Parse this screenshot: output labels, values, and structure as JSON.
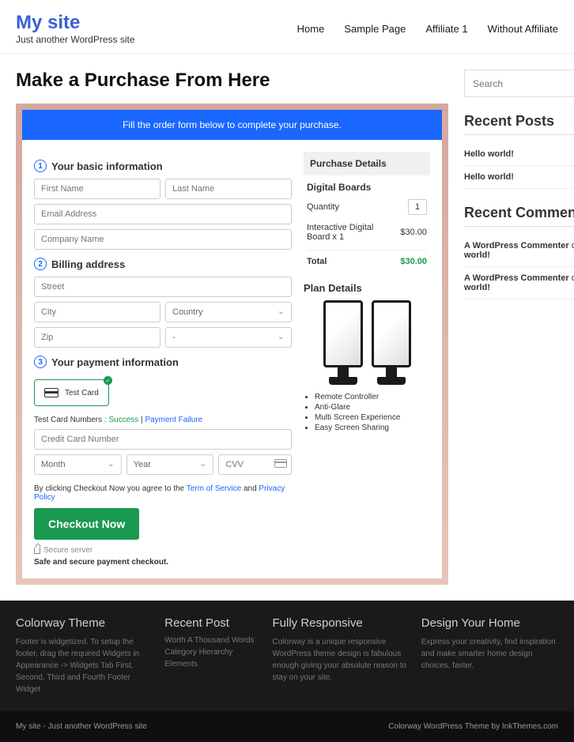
{
  "header": {
    "site_title": "My site",
    "tagline": "Just another WordPress site",
    "nav": [
      "Home",
      "Sample Page",
      "Affiliate 1",
      "Without Affiliate"
    ]
  },
  "page": {
    "title": "Make a Purchase From Here"
  },
  "form": {
    "banner": "Fill the order form below to complete your purchase.",
    "s1": {
      "num": "1",
      "title": "Your basic information",
      "first_name": "First Name",
      "last_name": "Last Name",
      "email": "Email Address",
      "company": "Company Name"
    },
    "s2": {
      "num": "2",
      "title": "Billing address",
      "street": "Street",
      "city": "City",
      "country": "Country",
      "zip": "Zip",
      "dash": "-"
    },
    "s3": {
      "num": "3",
      "title": "Your payment information",
      "card_label": "Test  Card",
      "test_prefix": "Test Card Numbers : ",
      "success": "Success",
      "sep": " | ",
      "failure": "Payment Failure",
      "ccnum": "Credit Card Number",
      "month": "Month",
      "year": "Year",
      "cvv": "CVV"
    },
    "agree": {
      "p1": "By clicking Checkout Now you agree to the ",
      "tos": "Term of Service",
      "and": " and ",
      "pp": "Privacy Policy"
    },
    "checkout": "Checkout Now",
    "secure": "Secure server",
    "safe": "Safe and secure payment checkout."
  },
  "purchase": {
    "head": "Purchase Details",
    "product": "Digital Boards",
    "qty_label": "Quantity",
    "qty": "1",
    "item": "Interactive Digital Board x 1",
    "price": "$30.00",
    "total_label": "Total",
    "total": "$30.00",
    "plan_title": "Plan Details",
    "features": [
      "Remote Controller",
      "Anti-Glare",
      "Multi Screen Experience",
      "Easy Screen Sharing"
    ]
  },
  "sidebar": {
    "search_placeholder": "Search",
    "recent_posts_title": "Recent Posts",
    "posts": [
      "Hello world!",
      "Hello world!"
    ],
    "recent_comments_title": "Recent Comments",
    "comments": [
      {
        "author": "A WordPress Commenter",
        "on": " on ",
        "post": "Hello world!"
      },
      {
        "author": "A WordPress Commenter",
        "on": " on ",
        "post": "Hello world!"
      }
    ]
  },
  "footer": {
    "col1": {
      "title": "Colorway Theme",
      "text": "Footer is widgetized. To setup the footer, drag the required Widgets in Appearance -> Widgets Tab First, Second, Third and Fourth Footer Widget"
    },
    "col2": {
      "title": "Recent Post",
      "items": [
        "Worth A Thousand Words",
        "Category Hierarchy",
        "Elements"
      ]
    },
    "col3": {
      "title": "Fully Responsive",
      "text": "Colorway is a unique responsive WordPress theme design is fabulous enough giving your absolute reason to stay on your site."
    },
    "col4": {
      "title": "Design Your Home",
      "text": "Express your creativity, find inspiration and make smarter home design choices, faster."
    },
    "bar_left": "My site - Just another WordPress site",
    "bar_right": "Colorway WordPress Theme by InkThemes.com"
  }
}
